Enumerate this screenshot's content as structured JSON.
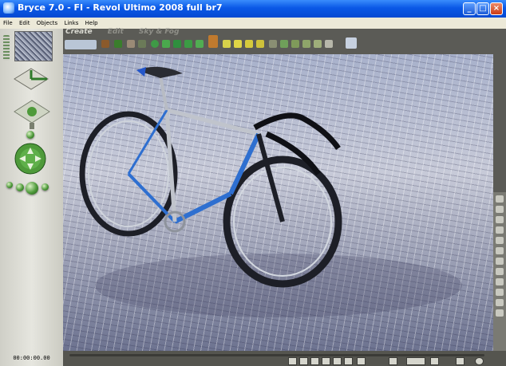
{
  "window": {
    "title": "Bryce 7.0 - FI - Revol Ultimo 2008 full br7",
    "minimize_label": "_",
    "maximize_label": "□",
    "close_label": "×"
  },
  "menu": [
    "File",
    "Edit",
    "Objects",
    "Links",
    "Help"
  ],
  "tabs": [
    "Create",
    "Edit",
    "Sky & Fog"
  ],
  "status": {
    "timecode": "00:00:00.00"
  },
  "colors": {
    "titlebar": "#0a58e6",
    "panel": "#e6e6df",
    "workspace": "#5b5b56",
    "accent_green": "#4e9a3a"
  }
}
